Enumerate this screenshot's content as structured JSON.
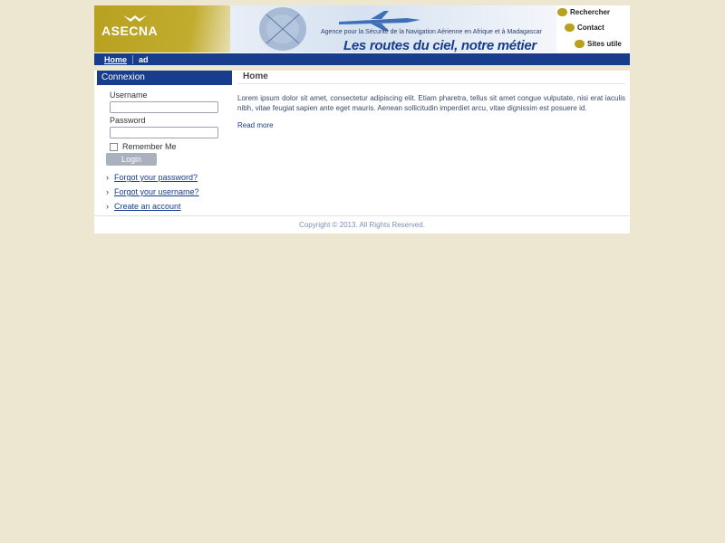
{
  "header": {
    "logo": "ASECNA",
    "tagline_small": "Agence pour la Sécurité de la Navigation Aérienne en Afrique et à Madagascar",
    "tagline": "Les routes du ciel, notre métier",
    "links": [
      {
        "label": "Rechercher",
        "icon": "search-icon"
      },
      {
        "label": "Contact",
        "icon": "mail-icon"
      },
      {
        "label": "Sites utile",
        "icon": "sites-icon"
      }
    ]
  },
  "nav": {
    "items": [
      {
        "label": "Home",
        "active": true
      },
      {
        "label": "ad",
        "active": false
      }
    ]
  },
  "sidebar": {
    "title": "Connexion",
    "username_label": "Username",
    "username_value": "",
    "password_label": "Password",
    "password_value": "",
    "remember_label": "Remember Me",
    "remember_checked": false,
    "login_label": "Login",
    "links": [
      {
        "label": "Forgot your password?"
      },
      {
        "label": "Forgot your username?"
      },
      {
        "label": "Create an account"
      }
    ]
  },
  "content": {
    "title": "Home",
    "text": "Lorem ipsum dolor sit amet, consectetur adipiscing elit. Etiam pharetra, tellus sit amet congue vulputate, nisi erat iaculis nibh, vitae feugiat sapien ante eget mauris. Aenean sollicitudin imperdiet arcu, vitae dignissim est posuere id.",
    "read_more": "Read more"
  },
  "footer": {
    "copyright": "Copyright © 2013. All Rights Reserved."
  },
  "colors": {
    "background": "#ede6d0",
    "brand_gold": "#b8a11f",
    "brand_blue": "#173d8c"
  }
}
